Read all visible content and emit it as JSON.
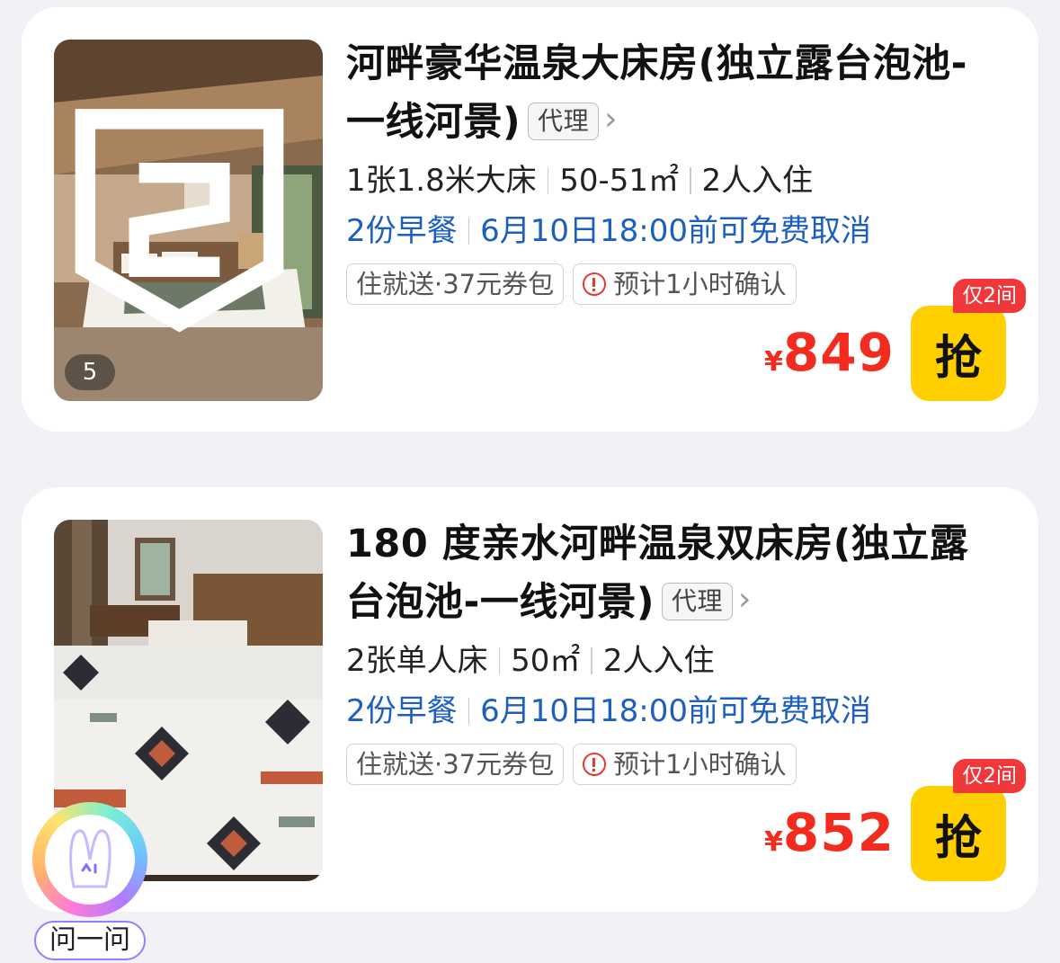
{
  "rooms": [
    {
      "title": "河畔豪华温泉大床房(独立露台泡池-一线河景)",
      "agent_tag": "代理",
      "bed": "1张1.8米大床",
      "area": "50-51㎡",
      "occupancy": "2人入住",
      "breakfast": "2份早餐",
      "cancel": "6月10日18:00前可免费取消",
      "tag_coupon": "住就送·37元券包",
      "tag_confirm": "预计1小时确认",
      "photo_count": "5",
      "currency": "¥",
      "price": "849",
      "stock": "仅2间",
      "buy_label": "抢"
    },
    {
      "title": "180 度亲水河畔温泉双床房(独立露台泡池-一线河景)",
      "agent_tag": "代理",
      "bed": "2张单人床",
      "area": "50㎡",
      "occupancy": "2人入住",
      "breakfast": "2份早餐",
      "cancel": "6月10日18:00前可免费取消",
      "tag_coupon": "住就送·37元券包",
      "tag_confirm": "预计1小时确认",
      "currency": "¥",
      "price": "852",
      "stock": "仅2间",
      "buy_label": "抢"
    }
  ],
  "assistant": {
    "label": "问一问"
  },
  "colors": {
    "price": "#f22d1f",
    "buy_button": "#ffcf00",
    "perk_blue": "#1d5fbf",
    "stock_badge": "#f0383b"
  },
  "icons": [
    "chevron-right-icon",
    "warning-icon",
    "vr-tour-icon",
    "assistant-bunny-icon"
  ]
}
